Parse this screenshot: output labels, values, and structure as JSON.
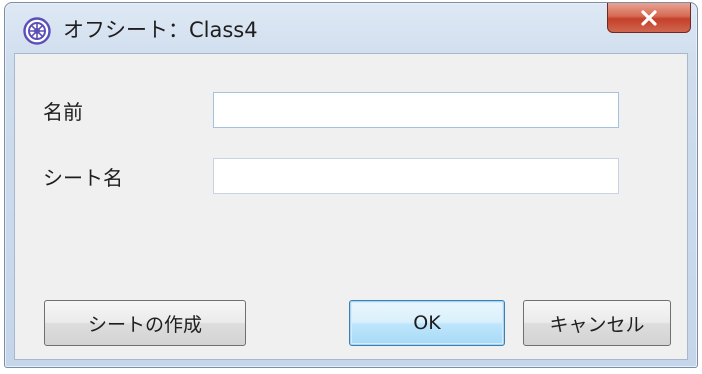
{
  "window": {
    "title": "オフシート：Class4",
    "close_symbol": "×",
    "icon": "app-logo-icon"
  },
  "form": {
    "name_label": "名前",
    "name_value": "",
    "sheet_name_label": "シート名",
    "sheet_name_value": ""
  },
  "buttons": {
    "create_sheet_label": "シートの作成",
    "ok_label": "OK",
    "cancel_label": "キャンセル"
  },
  "colors": {
    "close_button": "#d0574a",
    "default_button_border": "#3c7fb1",
    "icon_accent": "#5b4fb8"
  }
}
